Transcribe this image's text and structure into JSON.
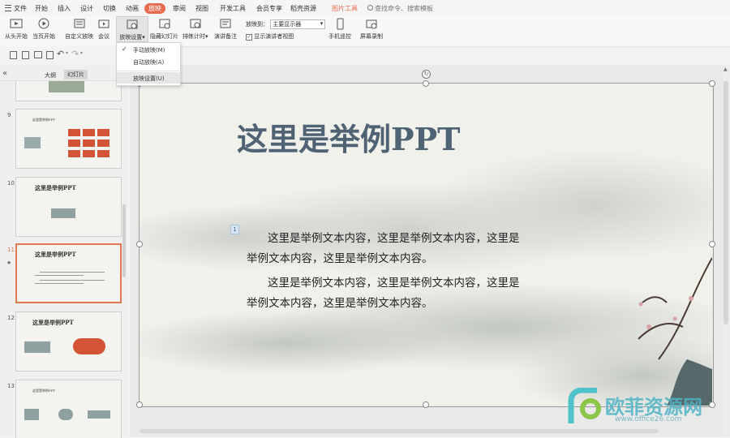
{
  "menu": {
    "hamburger_label": "文件",
    "items": [
      "开始",
      "插入",
      "设计",
      "切换",
      "动画",
      "放映",
      "审阅",
      "视图",
      "开发工具",
      "会员专享",
      "稻壳资源"
    ],
    "active": "放映",
    "picture_tools": "图片工具",
    "search_placeholder": "查找命令、搜索模板"
  },
  "ribbon": {
    "from_start": "从头开始",
    "from_current": "当页开始",
    "custom_show": "自定义放映",
    "meeting": "会议",
    "slideshow_settings": "放映设置",
    "hide_slide": "隐藏幻灯片",
    "rehearse": "排练计时",
    "speaker_notes": "演讲备注",
    "show_to_label": "放映到：",
    "show_to_value": "主要显示器",
    "presenter_view": "显示演讲者视图",
    "phone_remote": "手机遥控",
    "screen_record": "屏幕录制"
  },
  "dropdown": {
    "manual": "手动放映(M)",
    "auto": "自动放映(A)",
    "settings": "放映设置(U)"
  },
  "panel": {
    "collapse": "«",
    "tab_outline": "大纲",
    "tab_slides": "幻灯片",
    "active_tab": "幻灯片",
    "slides": [
      {
        "num": "9",
        "title": "这里是举例PPT"
      },
      {
        "num": "10",
        "title": "这里是举例PPT"
      },
      {
        "num": "11",
        "title": "这里是举例PPT",
        "selected": true,
        "star": "★"
      },
      {
        "num": "12",
        "title": "这里是举例PPT"
      },
      {
        "num": "13",
        "title": "这里是举例PPT"
      }
    ]
  },
  "slide": {
    "title": "这里是举例PPT",
    "tag": "1",
    "para1_line1": "这里是举例文本内容，这里是举例文本内容，这里是",
    "para1_line2": "举例文本内容，这里是举例文本内容。",
    "para2_line1": "这里是举例文本内容，这里是举例文本内容，这里是",
    "para2_line2": "举例文本内容，这里是举例文本内容。"
  },
  "watermark": {
    "text": "欧菲资源网",
    "url": "www.office26.com"
  },
  "colors": {
    "accent": "#e66a4e",
    "title": "#4f6374",
    "selection": "#e07a52"
  }
}
